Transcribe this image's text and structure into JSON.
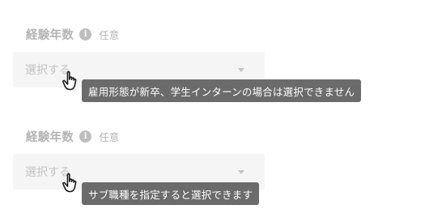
{
  "fields": [
    {
      "label": "経験年数",
      "info_icon": "info-icon",
      "optional": "任意",
      "select": {
        "placeholder": "選択する",
        "caret_icon": "caret-down-icon"
      },
      "tooltip": "雇用形態が新卒、学生インターンの場合は選択できません",
      "cursor_icon": "hand-pointer-icon"
    },
    {
      "label": "経験年数",
      "info_icon": "info-icon",
      "optional": "任意",
      "select": {
        "placeholder": "選択する",
        "caret_icon": "caret-down-icon"
      },
      "tooltip": "サブ職種を指定すると選択できます",
      "cursor_icon": "hand-pointer-icon"
    }
  ]
}
